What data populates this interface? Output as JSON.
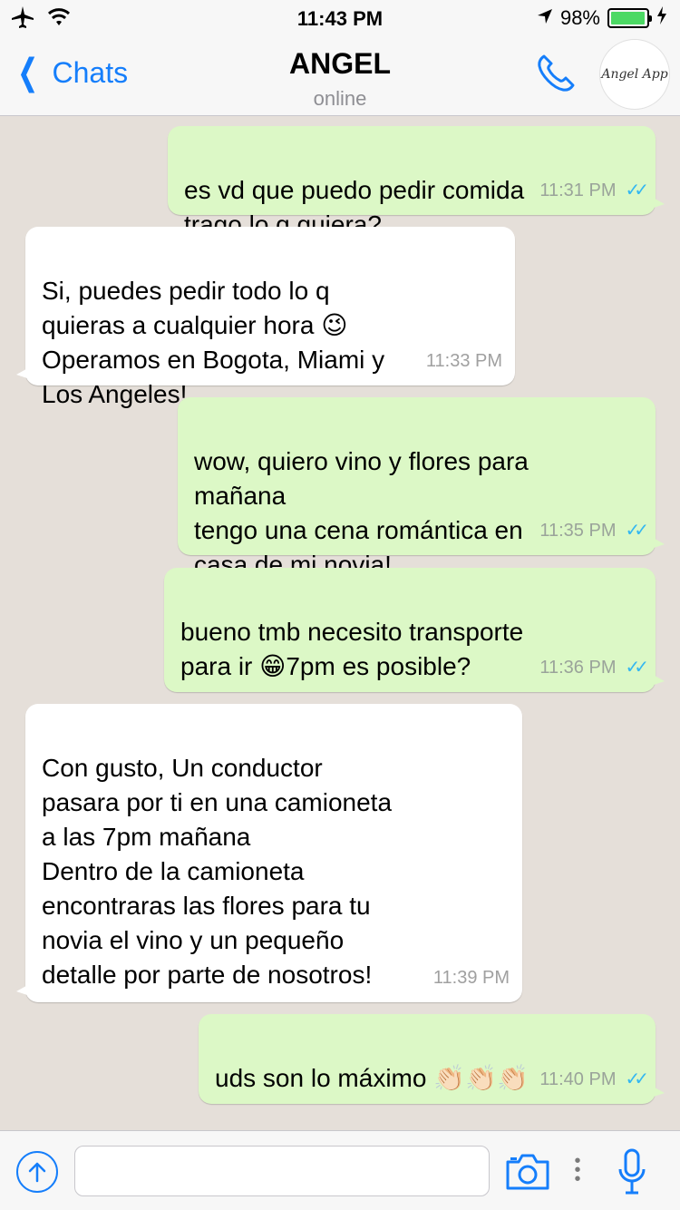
{
  "status_bar": {
    "time": "11:43 PM",
    "battery": "98%",
    "battery_level": 0.98
  },
  "nav": {
    "back_label": "Chats",
    "title": "ANGEL",
    "subtitle": "online",
    "avatar_text": "Angel App"
  },
  "messages": [
    {
      "dir": "out",
      "text": "es vd que puedo pedir comida\ntrago lo q quiera?",
      "time": "11:31 PM",
      "read": true
    },
    {
      "dir": "in",
      "text": "Si, puedes pedir todo lo q\nquieras a cualquier hora 😉\nOperamos en Bogota, Miami y\nLos Angeles!",
      "time": "11:33 PM"
    },
    {
      "dir": "out",
      "text": "wow, quiero vino y flores para\nmañana\ntengo una cena romántica en\ncasa de mi novia!",
      "time": "11:35 PM",
      "read": true
    },
    {
      "dir": "out",
      "text": "bueno tmb necesito transporte\npara ir 😁7pm es posible?",
      "time": "11:36 PM",
      "read": true
    },
    {
      "dir": "in",
      "text": "Con gusto, Un conductor\npasara por ti en una camioneta\na las 7pm mañana\nDentro de la camioneta\nencontraras las flores para tu\nnovia el vino y un pequeño\ndetalle por parte de nosotros!",
      "time": "11:39 PM"
    },
    {
      "dir": "out",
      "text": "uds son lo máximo 👏🏻👏🏻👏🏻",
      "time": "11:40 PM",
      "read": true
    }
  ],
  "input": {
    "placeholder": ""
  },
  "colors": {
    "accent": "#157efb",
    "outgoing_bubble": "#dcf8c6",
    "incoming_bubble": "#ffffff",
    "chat_background": "#e5dfd9",
    "read_ticks": "#34b7f1"
  },
  "icons": {
    "airplane": "airplane-icon",
    "wifi": "wifi-icon",
    "location": "location-arrow-icon",
    "charging": "charging-bolt-icon",
    "back": "chevron-left-icon",
    "call": "phone-icon",
    "upload": "upload-arrow-icon",
    "camera": "camera-icon",
    "more": "more-dots-icon",
    "mic": "microphone-icon"
  }
}
